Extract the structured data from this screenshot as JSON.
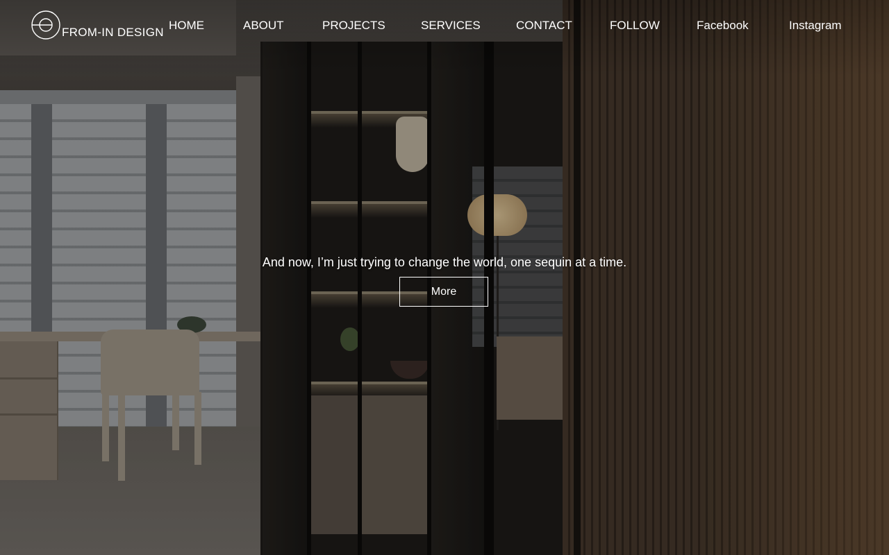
{
  "brand": {
    "name": "FROM-IN DESIGN",
    "logo_icon": "circle-monogram-icon"
  },
  "nav": {
    "items": [
      {
        "label": "HOME"
      },
      {
        "label": "ABOUT"
      },
      {
        "label": "PROJECTS"
      },
      {
        "label": "SERVICES"
      },
      {
        "label": "CONTACT"
      },
      {
        "label": "FOLLOW"
      },
      {
        "label": "Facebook"
      },
      {
        "label": "Instagram"
      }
    ]
  },
  "hero": {
    "tagline": "And now, I’m just trying to change the world, one sequin at a time.",
    "button_label": "More",
    "background": "interior-photo"
  },
  "colors": {
    "text": "#ffffff",
    "wood": "#4a3b2e",
    "cabinet": "#1f1c1a"
  }
}
